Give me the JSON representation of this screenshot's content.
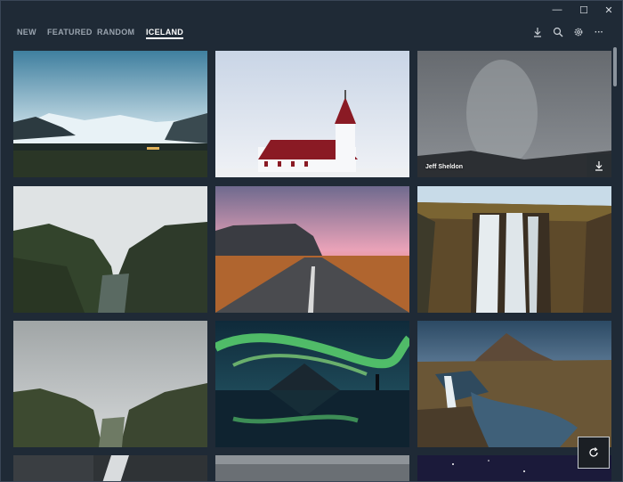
{
  "window": {
    "minimize_glyph": "—",
    "maximize_glyph": "☐",
    "close_glyph": "✕"
  },
  "tabs": [
    {
      "label": "NEW"
    },
    {
      "label": "FEATURED"
    },
    {
      "label": "RANDOM"
    },
    {
      "label": "ICELAND",
      "active": true
    }
  ],
  "toolbar": {
    "icons": [
      "download-icon",
      "search-icon",
      "gear-icon",
      "more-icon"
    ],
    "more_glyph": "···"
  },
  "gallery": {
    "photos": [
      {
        "subject": "glacier"
      },
      {
        "subject": "church"
      },
      {
        "subject": "waterfall-mist",
        "credit": "Jeff Sheldon"
      },
      {
        "subject": "canyon"
      },
      {
        "subject": "road"
      },
      {
        "subject": "waterfall"
      },
      {
        "subject": "cliffs"
      },
      {
        "subject": "aurora"
      },
      {
        "subject": "kirkjufell"
      }
    ]
  },
  "colors": {
    "accent": "#ffffff",
    "background": "#1f2a36",
    "tab_inactive": "#9aa4af"
  }
}
